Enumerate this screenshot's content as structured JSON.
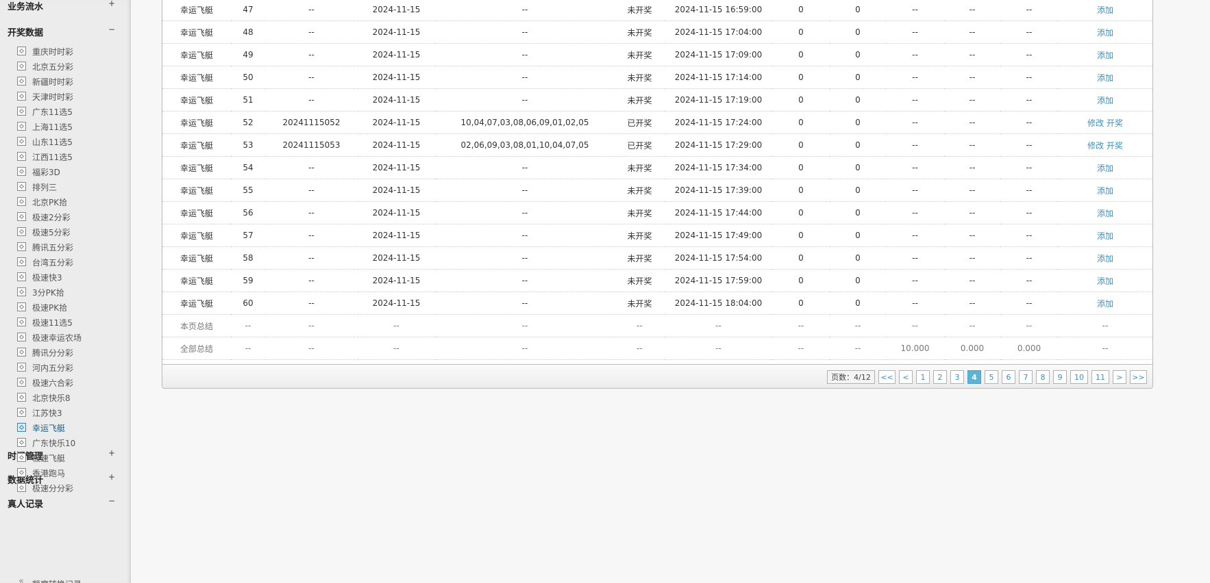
{
  "sidebar": {
    "sections": [
      {
        "title": "业务流水",
        "sign": "+"
      },
      {
        "title": "开奖数据",
        "sign": "−"
      },
      {
        "title": "时间管理",
        "sign": "+"
      },
      {
        "title": "数据统计",
        "sign": "+"
      },
      {
        "title": "真人记录",
        "sign": "−"
      }
    ],
    "items": [
      "重庆时时彩",
      "北京五分彩",
      "新疆时时彩",
      "天津时时彩",
      "广东11选5",
      "上海11选5",
      "山东11选5",
      "江西11选5",
      "福彩3D",
      "排列三",
      "北京PK拾",
      "极速2分彩",
      "极速5分彩",
      "腾讯五分彩",
      "台湾五分彩",
      "极速快3",
      "3分PK拾",
      "极速PK拾",
      "极速11选5",
      "极速幸运农场",
      "腾讯分分彩",
      "河内五分彩",
      "极速六合彩",
      "北京快乐8",
      "江苏快3",
      "幸运飞艇",
      "广东快乐10",
      "极速飞艇",
      "香港跑马",
      "极速分分彩"
    ],
    "active_item": "幸运飞艇",
    "bottom_item": "额度转换记录"
  },
  "table": {
    "rows": [
      {
        "game": "幸运飞艇",
        "seq": "47",
        "issue": "--",
        "date": "2024-11-15",
        "numbers": "--",
        "status": "未开奖",
        "time": "2024-11-15 16:59:00",
        "c1": "0",
        "c2": "0",
        "c3": "--",
        "c4": "--",
        "c5": "--",
        "act": [
          "添加"
        ]
      },
      {
        "game": "幸运飞艇",
        "seq": "48",
        "issue": "--",
        "date": "2024-11-15",
        "numbers": "--",
        "status": "未开奖",
        "time": "2024-11-15 17:04:00",
        "c1": "0",
        "c2": "0",
        "c3": "--",
        "c4": "--",
        "c5": "--",
        "act": [
          "添加"
        ]
      },
      {
        "game": "幸运飞艇",
        "seq": "49",
        "issue": "--",
        "date": "2024-11-15",
        "numbers": "--",
        "status": "未开奖",
        "time": "2024-11-15 17:09:00",
        "c1": "0",
        "c2": "0",
        "c3": "--",
        "c4": "--",
        "c5": "--",
        "act": [
          "添加"
        ]
      },
      {
        "game": "幸运飞艇",
        "seq": "50",
        "issue": "--",
        "date": "2024-11-15",
        "numbers": "--",
        "status": "未开奖",
        "time": "2024-11-15 17:14:00",
        "c1": "0",
        "c2": "0",
        "c3": "--",
        "c4": "--",
        "c5": "--",
        "act": [
          "添加"
        ]
      },
      {
        "game": "幸运飞艇",
        "seq": "51",
        "issue": "--",
        "date": "2024-11-15",
        "numbers": "--",
        "status": "未开奖",
        "time": "2024-11-15 17:19:00",
        "c1": "0",
        "c2": "0",
        "c3": "--",
        "c4": "--",
        "c5": "--",
        "act": [
          "添加"
        ]
      },
      {
        "game": "幸运飞艇",
        "seq": "52",
        "issue": "20241115052",
        "date": "2024-11-15",
        "numbers": "10,04,07,03,08,06,09,01,02,05",
        "status": "已开奖",
        "time": "2024-11-15 17:24:00",
        "c1": "0",
        "c2": "0",
        "c3": "--",
        "c4": "--",
        "c5": "--",
        "act": [
          "修改",
          "开奖"
        ]
      },
      {
        "game": "幸运飞艇",
        "seq": "53",
        "issue": "20241115053",
        "date": "2024-11-15",
        "numbers": "02,06,09,03,08,01,10,04,07,05",
        "status": "已开奖",
        "time": "2024-11-15 17:29:00",
        "c1": "0",
        "c2": "0",
        "c3": "--",
        "c4": "--",
        "c5": "--",
        "act": [
          "修改",
          "开奖"
        ]
      },
      {
        "game": "幸运飞艇",
        "seq": "54",
        "issue": "--",
        "date": "2024-11-15",
        "numbers": "--",
        "status": "未开奖",
        "time": "2024-11-15 17:34:00",
        "c1": "0",
        "c2": "0",
        "c3": "--",
        "c4": "--",
        "c5": "--",
        "act": [
          "添加"
        ]
      },
      {
        "game": "幸运飞艇",
        "seq": "55",
        "issue": "--",
        "date": "2024-11-15",
        "numbers": "--",
        "status": "未开奖",
        "time": "2024-11-15 17:39:00",
        "c1": "0",
        "c2": "0",
        "c3": "--",
        "c4": "--",
        "c5": "--",
        "act": [
          "添加"
        ]
      },
      {
        "game": "幸运飞艇",
        "seq": "56",
        "issue": "--",
        "date": "2024-11-15",
        "numbers": "--",
        "status": "未开奖",
        "time": "2024-11-15 17:44:00",
        "c1": "0",
        "c2": "0",
        "c3": "--",
        "c4": "--",
        "c5": "--",
        "act": [
          "添加"
        ]
      },
      {
        "game": "幸运飞艇",
        "seq": "57",
        "issue": "--",
        "date": "2024-11-15",
        "numbers": "--",
        "status": "未开奖",
        "time": "2024-11-15 17:49:00",
        "c1": "0",
        "c2": "0",
        "c3": "--",
        "c4": "--",
        "c5": "--",
        "act": [
          "添加"
        ]
      },
      {
        "game": "幸运飞艇",
        "seq": "58",
        "issue": "--",
        "date": "2024-11-15",
        "numbers": "--",
        "status": "未开奖",
        "time": "2024-11-15 17:54:00",
        "c1": "0",
        "c2": "0",
        "c3": "--",
        "c4": "--",
        "c5": "--",
        "act": [
          "添加"
        ]
      },
      {
        "game": "幸运飞艇",
        "seq": "59",
        "issue": "--",
        "date": "2024-11-15",
        "numbers": "--",
        "status": "未开奖",
        "time": "2024-11-15 17:59:00",
        "c1": "0",
        "c2": "0",
        "c3": "--",
        "c4": "--",
        "c5": "--",
        "act": [
          "添加"
        ]
      },
      {
        "game": "幸运飞艇",
        "seq": "60",
        "issue": "--",
        "date": "2024-11-15",
        "numbers": "--",
        "status": "未开奖",
        "time": "2024-11-15 18:04:00",
        "c1": "0",
        "c2": "0",
        "c3": "--",
        "c4": "--",
        "c5": "--",
        "act": [
          "添加"
        ]
      }
    ],
    "summary_rows": [
      {
        "label": "本页总结",
        "cells": [
          "--",
          "--",
          "--",
          "--",
          "--",
          "--",
          "--",
          "--",
          "--",
          "--",
          "--",
          "--"
        ]
      },
      {
        "label": "全部总结",
        "cells": [
          "--",
          "--",
          "--",
          "--",
          "--",
          "--",
          "--",
          "--",
          "10.000",
          "0.000",
          "0.000",
          "--"
        ]
      }
    ]
  },
  "pager": {
    "info": "页数：4/12",
    "first": "<<",
    "prev": "<",
    "pages": [
      "1",
      "2",
      "3",
      "4",
      "5",
      "6",
      "7",
      "8",
      "9",
      "10",
      "11"
    ],
    "current": "4",
    "next": ">",
    "last": ">>"
  }
}
